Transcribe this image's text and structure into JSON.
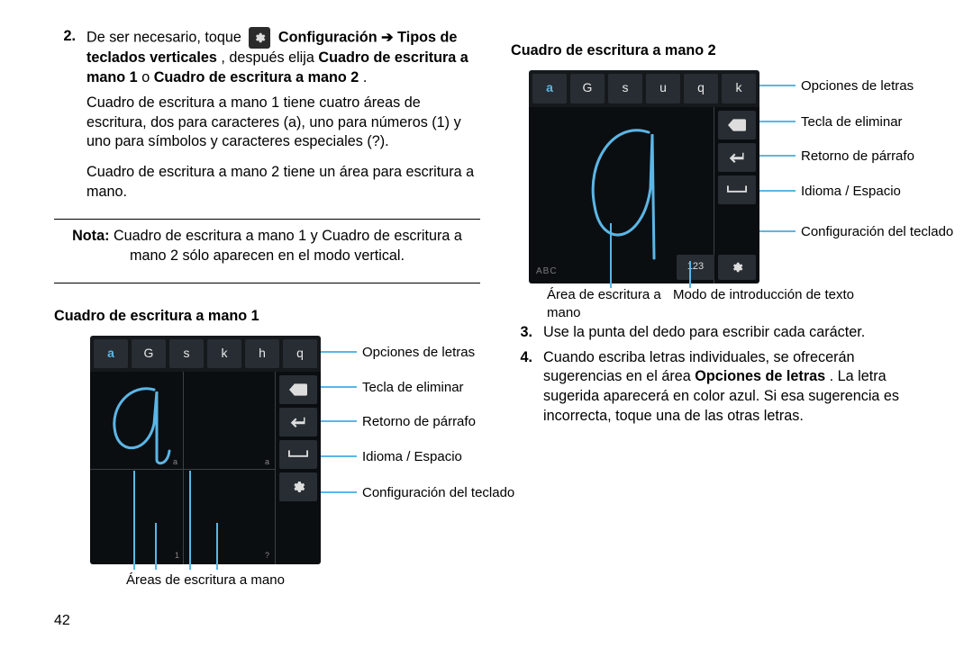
{
  "left": {
    "step2_num": "2.",
    "step2_p1a": "De ser necesario, toque ",
    "step2_p1b": "Configuración ➔ Tipos de teclados verticales",
    "step2_p1c": ", después elija ",
    "step2_p1d": "Cuadro de escritura a mano 1",
    "step2_p1e": " o ",
    "step2_p1f": "Cuadro de escritura a mano 2",
    "step2_p1g": ".",
    "step2_p2": "Cuadro de escritura a mano 1 tiene cuatro áreas de escritura, dos para caracteres (a), uno para números (1) y uno para símbolos y caracteres especiales (?).",
    "step2_p3": "Cuadro de escritura a mano 2 tiene un área para escritura a mano.",
    "nota_label": "Nota:",
    "nota_text": " Cuadro de escritura a mano 1 y Cuadro de escritura a mano 2 sólo aparecen en el modo vertical.",
    "title1": "Cuadro de escritura a mano 1",
    "fig1": {
      "keys": [
        "a",
        "G",
        "s",
        "k",
        "h",
        "q"
      ],
      "c_letters": "Opciones de letras",
      "c_delete": "Tecla de eliminar",
      "c_return": "Retorno de párrafo",
      "c_space": "Idioma / Espacio",
      "c_config": "Configuración del teclado",
      "c_areas": "Áreas de escritura a mano",
      "tiny_a1": "a",
      "tiny_a2": "a",
      "tiny_1": "1",
      "tiny_q": "?"
    }
  },
  "right": {
    "title2": "Cuadro de escritura a mano 2",
    "fig2": {
      "keys": [
        "a",
        "G",
        "s",
        "u",
        "q",
        "k"
      ],
      "c_letters": "Opciones de letras",
      "c_delete": "Tecla de eliminar",
      "c_return": "Retorno de párrafo",
      "c_space": "Idioma / Espacio",
      "c_config": "Configuración del teclado",
      "c_area": "Área de escritura a mano",
      "c_text": "Modo de introducción de texto",
      "abc": "ABC",
      "num123": "123"
    },
    "step3_num": "3.",
    "step3_text": "Use la punta del dedo para escribir cada carácter.",
    "step4_num": "4.",
    "step4_a": "Cuando escriba letras individuales, se ofrecerán sugerencias en el área ",
    "step4_b": "Opciones de letras",
    "step4_c": ". La letra sugerida aparecerá en color azul. Si esa sugerencia es incorrecta, toque una de las otras letras."
  },
  "page_number": "42"
}
